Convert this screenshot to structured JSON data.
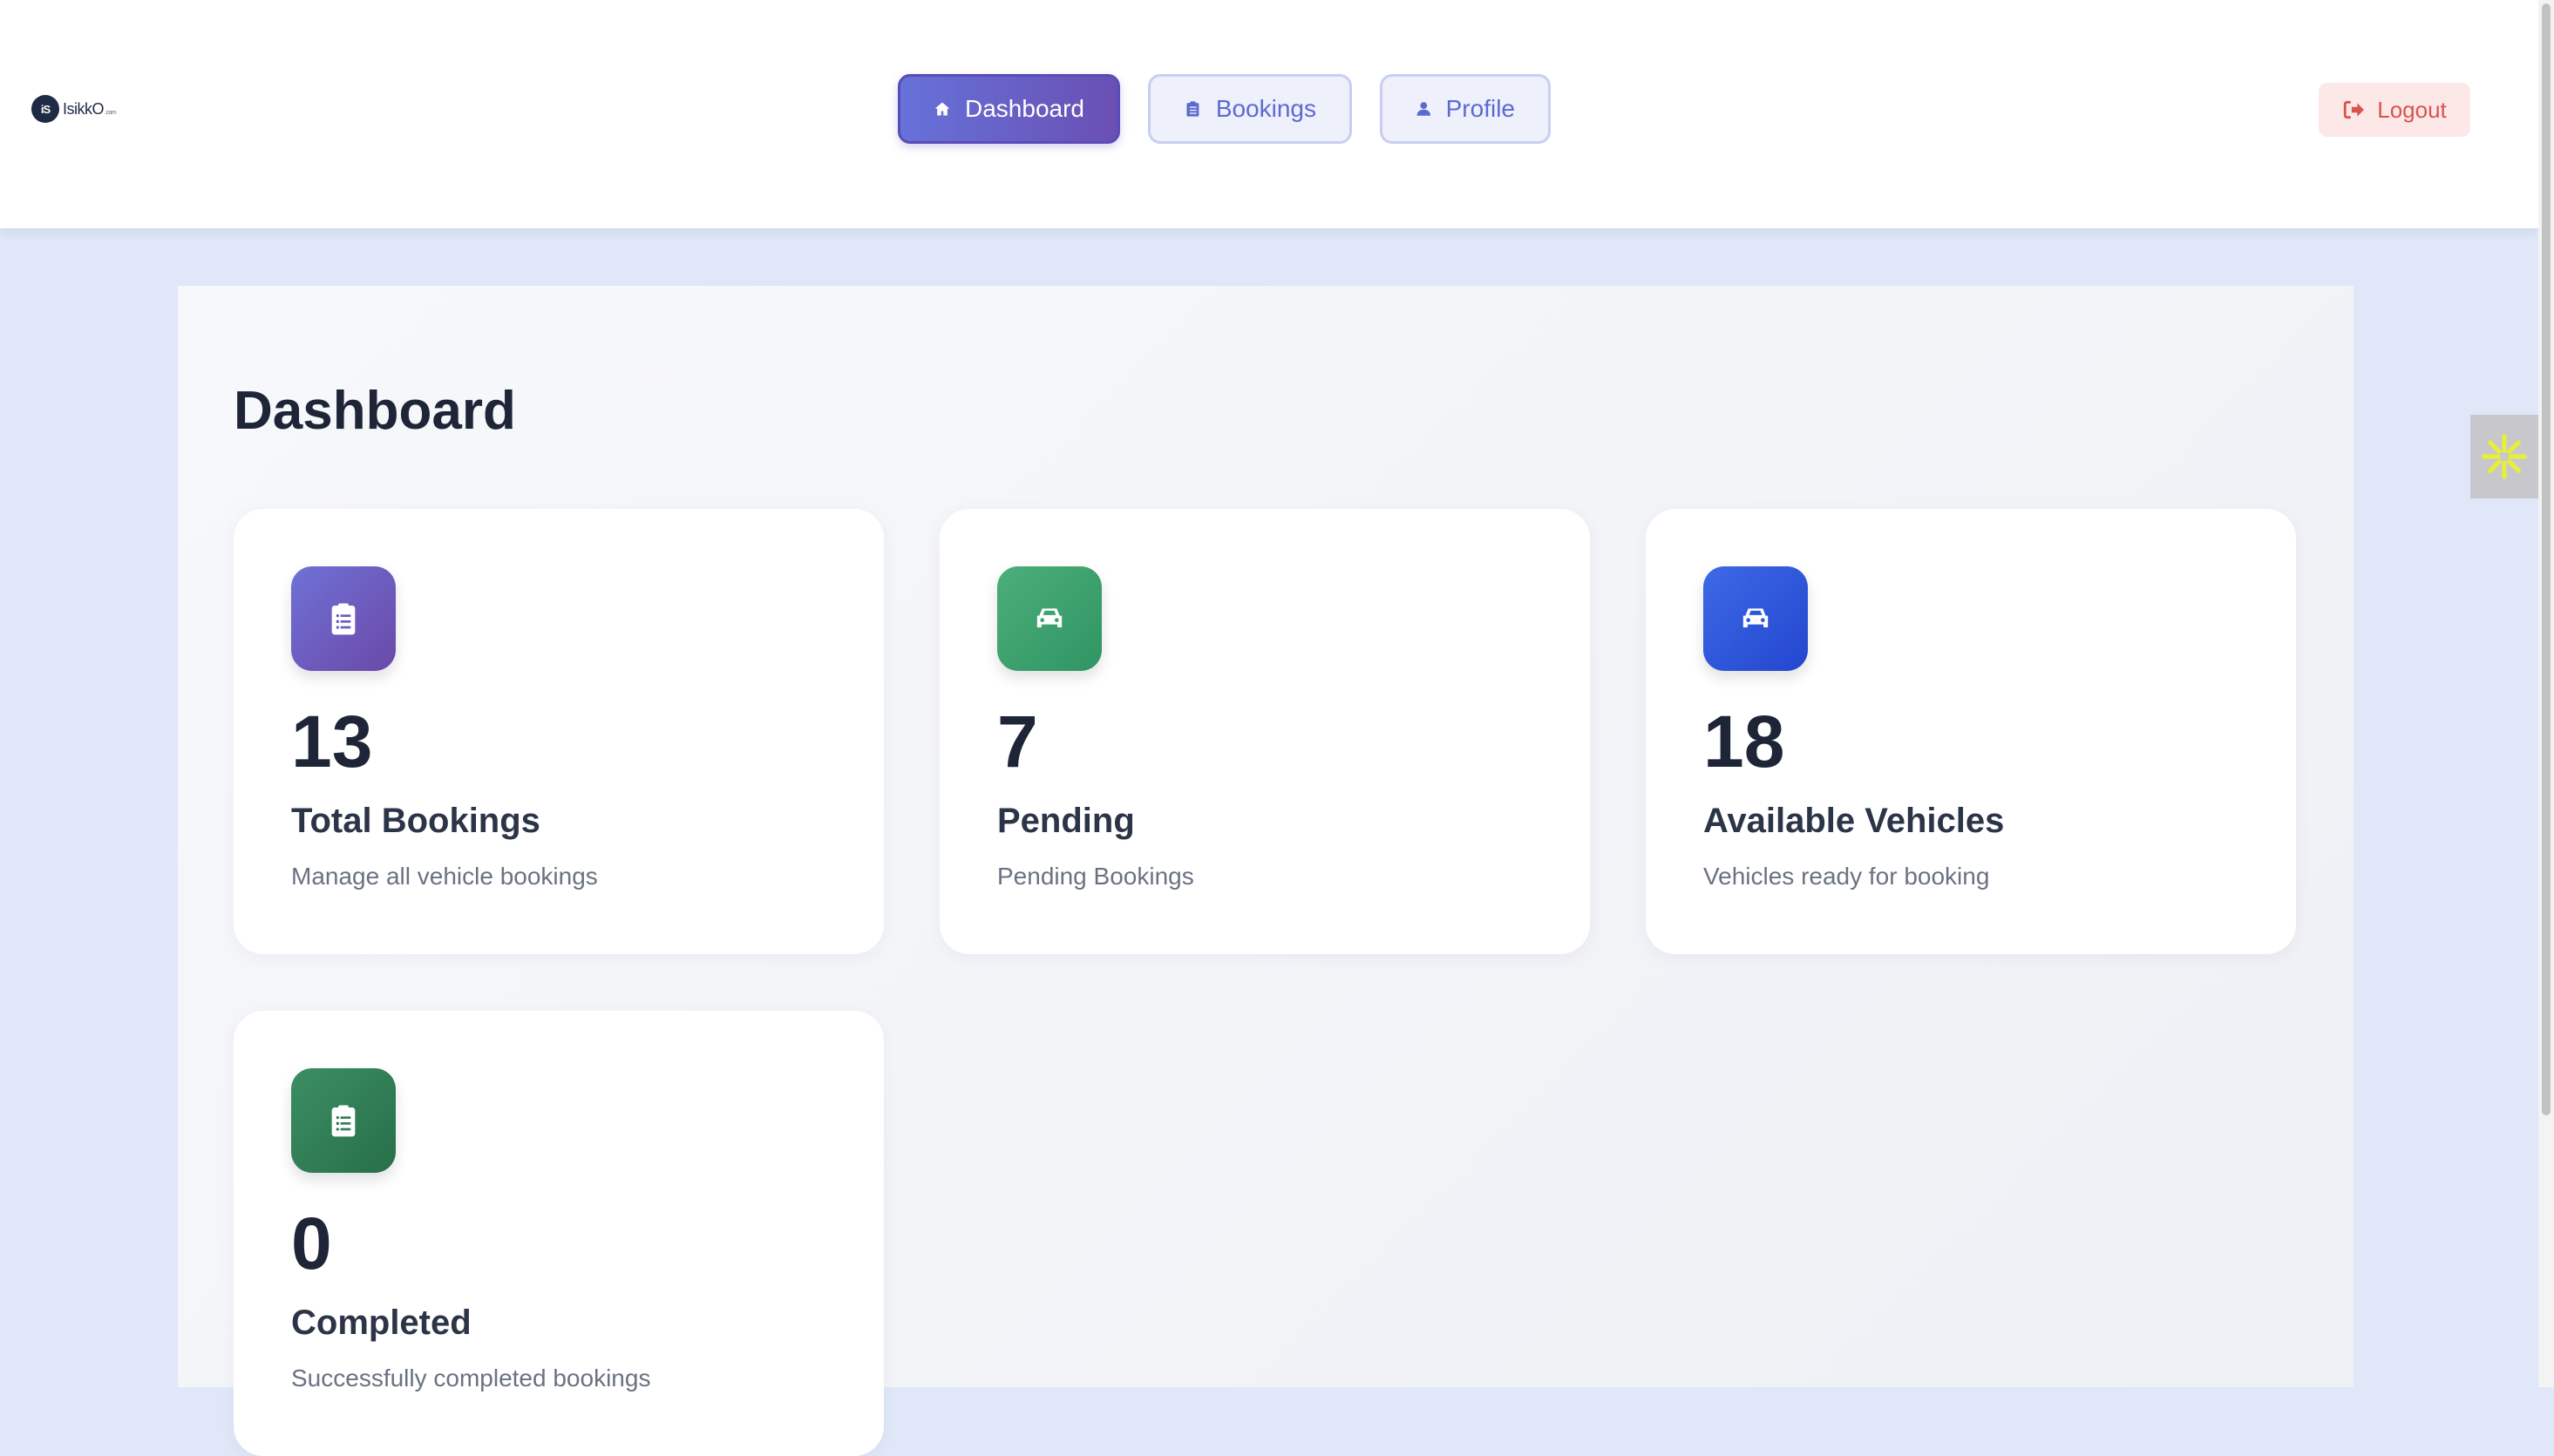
{
  "header": {
    "logo_mark": "iS",
    "logo_text": "IsikkO",
    "logo_suffix": ".com",
    "nav": [
      {
        "label": "Dashboard",
        "icon": "home-icon",
        "active": true
      },
      {
        "label": "Bookings",
        "icon": "clipboard-icon",
        "active": false
      },
      {
        "label": "Profile",
        "icon": "user-icon",
        "active": false
      }
    ],
    "logout_label": "Logout"
  },
  "page": {
    "title": "Dashboard"
  },
  "cards": [
    {
      "value": "13",
      "label": "Total Bookings",
      "desc": "Manage all vehicle bookings",
      "icon": "clipboard-list-icon",
      "color": "#6a5fc1"
    },
    {
      "value": "7",
      "label": "Pending",
      "desc": "Pending Bookings",
      "icon": "car-icon",
      "color": "#3fa26f"
    },
    {
      "value": "18",
      "label": "Available Vehicles",
      "desc": "Vehicles ready for booking",
      "icon": "car-icon",
      "color": "#2f57db"
    },
    {
      "value": "0",
      "label": "Completed",
      "desc": "Successfully completed bookings",
      "icon": "clipboard-list-icon",
      "color": "#327d56"
    }
  ],
  "colors": {
    "accent": "#6672d9",
    "logout": "#d9534f",
    "background": "#dfe7f8"
  }
}
